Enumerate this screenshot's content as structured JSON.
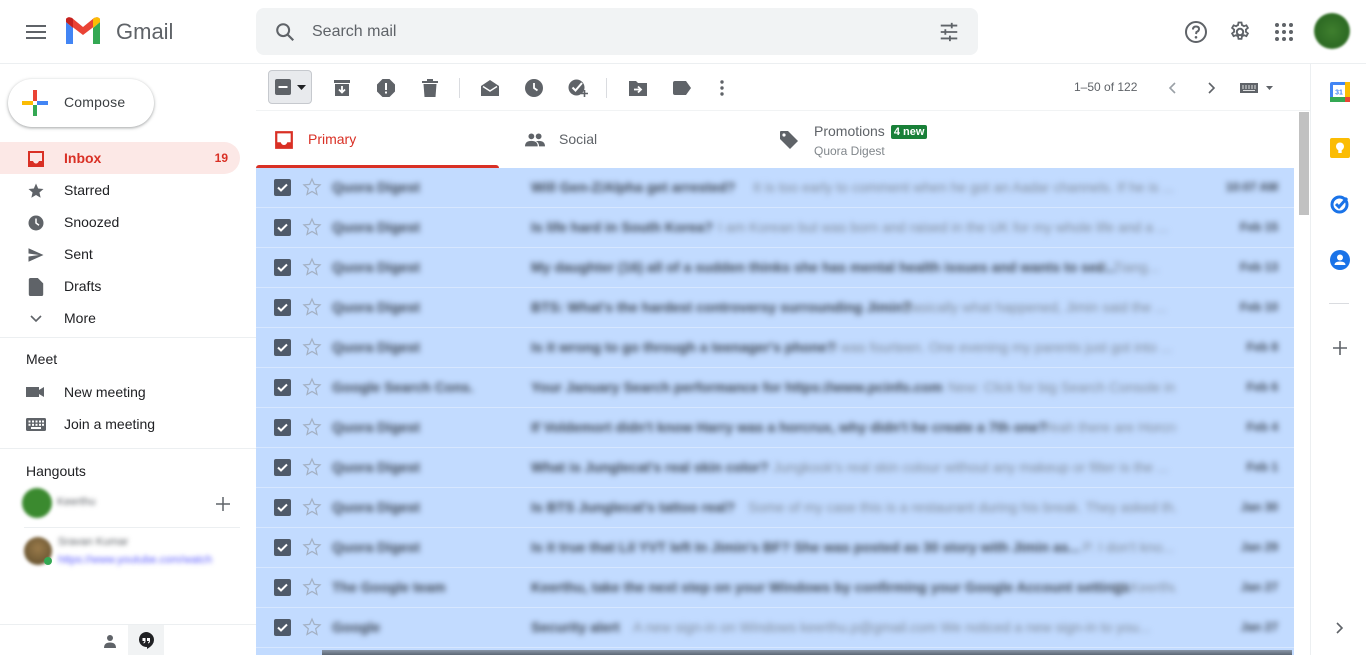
{
  "header": {
    "brand": "Gmail",
    "search_placeholder": "Search mail"
  },
  "sidebar": {
    "compose_label": "Compose",
    "items": [
      {
        "label": "Inbox",
        "count": "19",
        "icon": "inbox-icon",
        "active": true
      },
      {
        "label": "Starred",
        "icon": "star-icon"
      },
      {
        "label": "Snoozed",
        "icon": "clock-icon"
      },
      {
        "label": "Sent",
        "icon": "send-icon"
      },
      {
        "label": "Drafts",
        "icon": "draft-icon"
      },
      {
        "label": "More",
        "icon": "chevron-down-icon"
      }
    ],
    "meet": {
      "title": "Meet",
      "new_meeting": "New meeting",
      "join_meeting": "Join a meeting"
    },
    "hangouts": {
      "title": "Hangouts",
      "self_name": "Keerthu",
      "contact_name": "Sravan Kumar",
      "contact_status": "https://www.youtube.com/watch"
    }
  },
  "toolbar": {
    "pagination": "1–50 of 122"
  },
  "tabs": [
    {
      "label": "Primary",
      "icon": "inbox-icon",
      "active": true
    },
    {
      "label": "Social",
      "icon": "people-icon"
    },
    {
      "label": "Promotions",
      "icon": "tag-icon",
      "badge": "4 new",
      "subtitle": "Quora Digest"
    }
  ],
  "emails": [
    {
      "sender": "Quora Digest",
      "subject": "Will Gen-Z/Alpha get arrested?",
      "snippet": "It is too early to comment when he got an Aadar channels. If he is ...",
      "date": "10:07 AM",
      "selected": true
    },
    {
      "sender": "Quora Digest",
      "subject": "Is life hard in South Korea?",
      "snippet": "I am Korean but was born and raised in the UK for my whole life and a ...",
      "date": "Feb 15",
      "selected": true
    },
    {
      "sender": "Quora Digest",
      "subject": "My daughter (16) all of a sudden thinks she has mental health issues and wants to see...",
      "snippet": "P. Tiang...",
      "date": "Feb 13",
      "selected": true
    },
    {
      "sender": "Quora Digest",
      "subject": "BTS: What's the hardest controversy surrounding Jimin?",
      "snippet": "Basically what happened, Jimin said the ...",
      "date": "Feb 10",
      "selected": true
    },
    {
      "sender": "Quora Digest",
      "subject": "Is it wrong to go through a teenager's phone?",
      "snippet": "I was fourteen. One evening my parents just got into ...",
      "date": "Feb 8",
      "selected": true
    },
    {
      "sender": "Google Search Cons.",
      "subject": "Your January Search performance for https://www.pcinfo.com",
      "snippet": "New: Click for big Search Console in ...",
      "date": "Feb 6",
      "selected": true
    },
    {
      "sender": "Quora Digest",
      "subject": "If Voldemort didn't know Harry was a horcrux, why didn't he create a 7th one?",
      "snippet": "Yeah there are Horcrx...",
      "date": "Feb 4",
      "selected": true
    },
    {
      "sender": "Quora Digest",
      "subject": "What is Junglecat's real skin color?",
      "snippet": "Jungkook's real skin colour without any makeup or filter is the ...",
      "date": "Feb 1",
      "selected": true
    },
    {
      "sender": "Quora Digest",
      "subject": "Is BTS Junglecat's tattoo real?",
      "snippet": "Some of my case this is a restaurant during his break. They asked th...",
      "date": "Jan 30",
      "selected": true
    },
    {
      "sender": "Quora Digest",
      "subject": "Is it true that Lil YVT left In Jimin's BF? She was posted as 30 story with Jimin as...",
      "snippet": "P. I don't kno...",
      "date": "Jan 29",
      "selected": true
    },
    {
      "sender": "The Google team",
      "subject": "Keerthu, take the next step on your Windows by confirming your Google Account settings",
      "snippet": "Hi Keerthu...",
      "date": "Jan 27",
      "selected": true
    },
    {
      "sender": "Google",
      "subject": "Security alert",
      "snippet": "A new sign-in on Windows keerthu.p@gmail.com We noticed a new sign-in to you...",
      "date": "Jan 27",
      "selected": true
    }
  ],
  "colors": {
    "accent_red": "#d93025",
    "selected_row": "#c2dbff",
    "badge_green": "#188038"
  }
}
